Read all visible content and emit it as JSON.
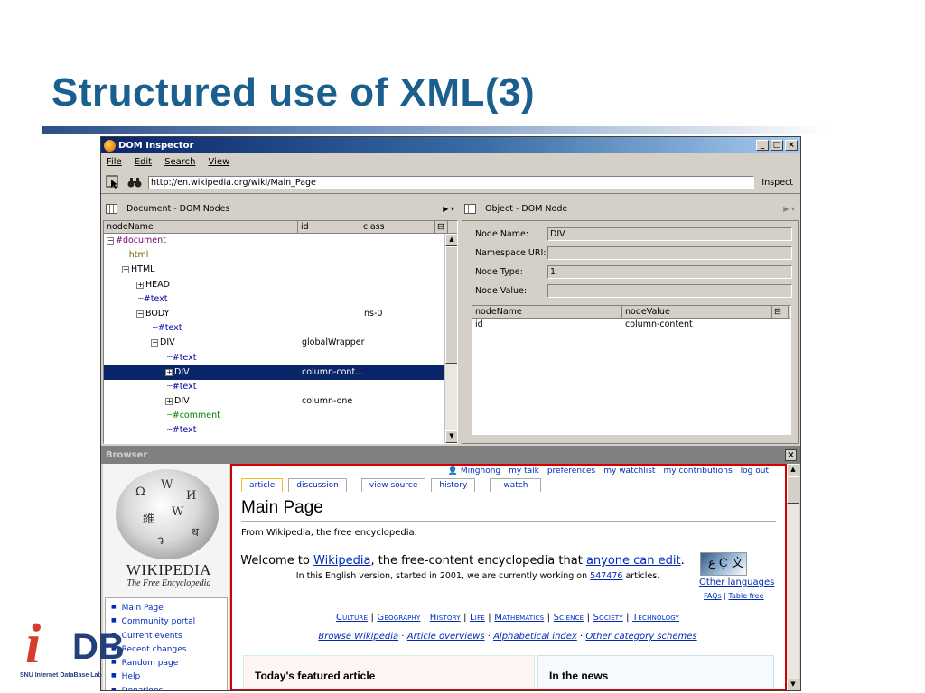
{
  "slide": {
    "title": "Structured use of XML(3)",
    "logo_i": "i",
    "logo_db": "DB",
    "logo_sub": "SNU Internet DataBase Lab"
  },
  "window": {
    "title": "DOM Inspector",
    "btn_min": "_",
    "btn_max": "□",
    "btn_close": "×",
    "menu": [
      "File",
      "Edit",
      "Search",
      "View"
    ],
    "url": "http://en.wikipedia.org/wiki/Main_Page",
    "inspect_label": "Inspect"
  },
  "left_pane": {
    "header": "Document - DOM Nodes",
    "columns": [
      "nodeName",
      "id",
      "class"
    ],
    "rows": [
      {
        "name": "#document",
        "id": "",
        "class": ""
      },
      {
        "name": "html",
        "id": "",
        "class": ""
      },
      {
        "name": "HTML",
        "id": "",
        "class": ""
      },
      {
        "name": "HEAD",
        "id": "",
        "class": ""
      },
      {
        "name": "#text",
        "id": "",
        "class": ""
      },
      {
        "name": "BODY",
        "id": "",
        "class": "ns-0"
      },
      {
        "name": "#text",
        "id": "",
        "class": ""
      },
      {
        "name": "DIV",
        "id": "globalWrapper",
        "class": ""
      },
      {
        "name": "#text",
        "id": "",
        "class": ""
      },
      {
        "name": "DIV",
        "id": "column-cont…",
        "class": ""
      },
      {
        "name": "#text",
        "id": "",
        "class": ""
      },
      {
        "name": "DIV",
        "id": "column-one",
        "class": ""
      },
      {
        "name": "#comment",
        "id": "",
        "class": ""
      },
      {
        "name": "#text",
        "id": "",
        "class": ""
      }
    ]
  },
  "right_pane": {
    "header": "Object - DOM Node",
    "node_name_label": "Node Name:",
    "node_name_value": "DIV",
    "namespace_label": "Namespace URI:",
    "namespace_value": "",
    "node_type_label": "Node Type:",
    "node_type_value": "1",
    "node_value_label": "Node Value:",
    "node_value_value": "",
    "attr_columns": [
      "nodeName",
      "nodeValue"
    ],
    "attr_rows": [
      {
        "name": "id",
        "value": "column-content"
      }
    ]
  },
  "browser": {
    "header": "Browser",
    "close": "×",
    "logo_title": "WIKIPEDIA",
    "logo_subtitle": "The Free Encyclopedia",
    "nav": [
      "Main Page",
      "Community portal",
      "Current events",
      "Recent changes",
      "Random page",
      "Help",
      "Donations"
    ],
    "userbar": [
      "Minghong",
      "my talk",
      "preferences",
      "my watchlist",
      "my contributions",
      "log out"
    ],
    "tabs": [
      "article",
      "discussion",
      "view source",
      "history",
      "watch"
    ],
    "page_title": "Main Page",
    "page_subtitle": "From Wikipedia, the free encyclopedia.",
    "welcome_pre": "Welcome to ",
    "welcome_link1": "Wikipedia",
    "welcome_mid": ", the free-content encyclopedia that ",
    "welcome_link2": "anyone can edit",
    "welcome_post": ".",
    "welcome2_pre": "In this English version, started in 2001, we are currently working on ",
    "welcome2_count": "547476",
    "welcome2_post": " articles.",
    "lang_glyphs": "ﻉ Ç 文",
    "other_languages": "Other languages",
    "faqs": "FAQs",
    "table_free": "Table free",
    "topics": [
      "Culture",
      "Geography",
      "History",
      "Life",
      "Mathematics",
      "Science",
      "Society",
      "Technology"
    ],
    "browse": [
      "Browse Wikipedia",
      "Article overviews",
      "Alphabetical index",
      "Other category schemes"
    ],
    "featured_title": "Today's featured article",
    "news_title": "In the news"
  }
}
